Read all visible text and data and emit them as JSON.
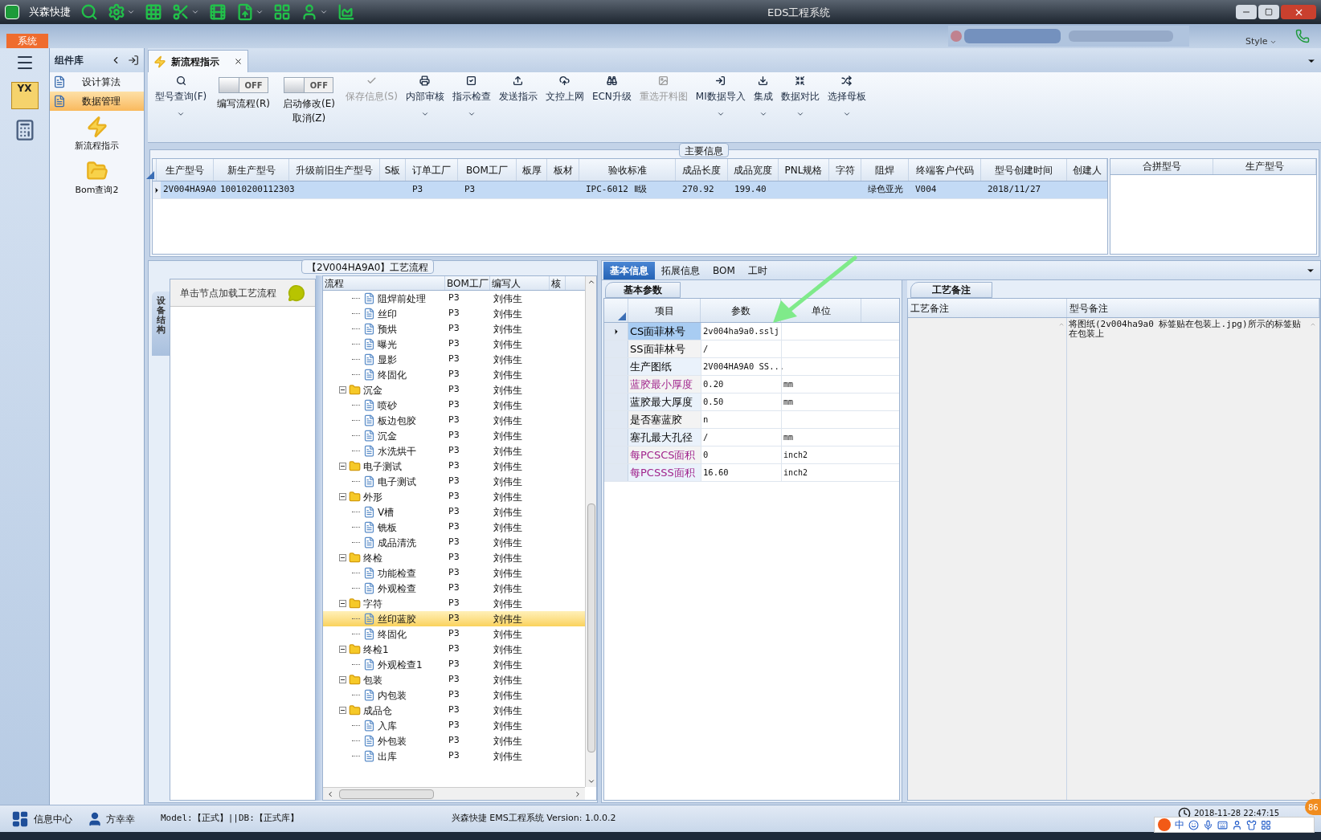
{
  "window": {
    "app_name": "兴森快捷",
    "title": "EDS工程系统"
  },
  "menu": {
    "tabs": [
      {
        "label": "系统",
        "selected": true
      }
    ],
    "style_label": "Style"
  },
  "nav_rail": {
    "logo_text": "YX"
  },
  "component_library": {
    "title": "组件库",
    "items": [
      {
        "label": "设计算法",
        "kind": "row",
        "selected": false
      },
      {
        "label": "数据管理",
        "kind": "row",
        "selected": true
      },
      {
        "label": "新流程指示",
        "kind": "tile",
        "selected": false
      },
      {
        "label": "Bom查询2",
        "kind": "tile",
        "selected": false
      }
    ]
  },
  "document_tabs": [
    {
      "label": "新流程指示",
      "selected": true
    }
  ],
  "ribbon": [
    {
      "kind": "button",
      "label": "型号查询(F)",
      "dropdown": true,
      "disabled": false
    },
    {
      "kind": "toggle",
      "label": "编写流程(R)",
      "switch_text": "OFF",
      "on": false
    },
    {
      "kind": "toggle",
      "label": "启动修改(E)",
      "label_2": "取消(Z)",
      "switch_text": "OFF",
      "on": false
    },
    {
      "kind": "button",
      "label": "保存信息(S)",
      "dropdown": false,
      "disabled": true
    },
    {
      "kind": "button",
      "label": "内部审核",
      "dropdown": true,
      "disabled": false
    },
    {
      "kind": "button",
      "label": "指示检查",
      "dropdown": true,
      "disabled": false
    },
    {
      "kind": "button",
      "label": "发送指示",
      "dropdown": false,
      "disabled": false
    },
    {
      "kind": "button",
      "label": "文控上网",
      "dropdown": false,
      "disabled": false
    },
    {
      "kind": "button",
      "label": "ECN升级",
      "dropdown": false,
      "disabled": false
    },
    {
      "kind": "button",
      "label": "重选开料图",
      "dropdown": false,
      "disabled": true
    },
    {
      "kind": "button",
      "label": "MI数据导入",
      "dropdown": true,
      "disabled": false
    },
    {
      "kind": "button",
      "label": "集成",
      "dropdown": true,
      "disabled": false
    },
    {
      "kind": "button",
      "label": "数据对比",
      "dropdown": true,
      "disabled": false
    },
    {
      "kind": "button",
      "label": "选择母板",
      "dropdown": true,
      "disabled": false
    }
  ],
  "main_info": {
    "title": "主要信息",
    "columns": [
      "生产型号",
      "新生产型号",
      "升级前旧生产型号",
      "S板",
      "订单工厂",
      "BOM工厂",
      "板厚",
      "板材",
      "验收标准",
      "成品长度",
      "成品宽度",
      "PNL规格",
      "字符",
      "阻焊",
      "终端客户代码",
      "型号创建时间",
      "创建人"
    ],
    "rows": [
      {
        "selected": true,
        "cells": [
          "2V004HA9A0",
          "10010200112303",
          null,
          null,
          "P3",
          "P3",
          null,
          null,
          "IPC-6012 Ⅱ级",
          "270.92",
          "199.40",
          null,
          null,
          "绿色亚光",
          "V004",
          "2018/11/27",
          null
        ]
      }
    ],
    "side_columns": [
      "合拼型号",
      "生产型号"
    ]
  },
  "flow_panel": {
    "title": "【2V004HA9A0】工艺流程",
    "side_tab": "设备结构",
    "hint": "单击节点加载工艺流程",
    "columns": [
      "流程",
      "BOM工厂",
      "编写人",
      "核"
    ],
    "tree": [
      {
        "children": [
          {
            "label": "阻焊前处理",
            "bom_factory": "P3",
            "writer": "刘伟生",
            "selected": false
          },
          {
            "label": "丝印",
            "bom_factory": "P3",
            "writer": "刘伟生",
            "selected": false
          },
          {
            "label": "预烘",
            "bom_factory": "P3",
            "writer": "刘伟生",
            "selected": false
          },
          {
            "label": "曝光",
            "bom_factory": "P3",
            "writer": "刘伟生",
            "selected": false
          },
          {
            "label": "显影",
            "bom_factory": "P3",
            "writer": "刘伟生",
            "selected": false
          },
          {
            "label": "终固化",
            "bom_factory": "P3",
            "writer": "刘伟生",
            "selected": false
          }
        ]
      },
      {
        "label": "沉金",
        "bom_factory": "P3",
        "writer": "刘伟生",
        "selected": false,
        "expanded": true,
        "children": [
          {
            "label": "喷砂",
            "bom_factory": "P3",
            "writer": "刘伟生",
            "selected": false
          },
          {
            "label": "板边包胶",
            "bom_factory": "P3",
            "writer": "刘伟生",
            "selected": false
          },
          {
            "label": "沉金",
            "bom_factory": "P3",
            "writer": "刘伟生",
            "selected": false
          },
          {
            "label": "水洗烘干",
            "bom_factory": "P3",
            "writer": "刘伟生",
            "selected": false
          }
        ]
      },
      {
        "label": "电子测试",
        "bom_factory": "P3",
        "writer": "刘伟生",
        "selected": false,
        "expanded": true,
        "children": [
          {
            "label": "电子测试",
            "bom_factory": "P3",
            "writer": "刘伟生",
            "selected": false
          }
        ]
      },
      {
        "label": "外形",
        "bom_factory": "P3",
        "writer": "刘伟生",
        "selected": false,
        "expanded": true,
        "children": [
          {
            "label": "V槽",
            "bom_factory": "P3",
            "writer": "刘伟生",
            "selected": false
          },
          {
            "label": "铣板",
            "bom_factory": "P3",
            "writer": "刘伟生",
            "selected": false
          },
          {
            "label": "成品清洗",
            "bom_factory": "P3",
            "writer": "刘伟生",
            "selected": false
          }
        ]
      },
      {
        "label": "终检",
        "bom_factory": "P3",
        "writer": "刘伟生",
        "selected": false,
        "expanded": true,
        "children": [
          {
            "label": "功能检查",
            "bom_factory": "P3",
            "writer": "刘伟生",
            "selected": false
          },
          {
            "label": "外观检查",
            "bom_factory": "P3",
            "writer": "刘伟生",
            "selected": false
          }
        ]
      },
      {
        "label": "字符",
        "bom_factory": "P3",
        "writer": "刘伟生",
        "selected": false,
        "expanded": true,
        "children": [
          {
            "label": "丝印蓝胶",
            "bom_factory": "P3",
            "writer": "刘伟生",
            "selected": true
          },
          {
            "label": "终固化",
            "bom_factory": "P3",
            "writer": "刘伟生",
            "selected": false
          }
        ]
      },
      {
        "label": "终检1",
        "bom_factory": "P3",
        "writer": "刘伟生",
        "selected": false,
        "expanded": true,
        "children": [
          {
            "label": "外观检查1",
            "bom_factory": "P3",
            "writer": "刘伟生",
            "selected": false
          }
        ]
      },
      {
        "label": "包装",
        "bom_factory": "P3",
        "writer": "刘伟生",
        "selected": false,
        "expanded": true,
        "children": [
          {
            "label": "内包装",
            "bom_factory": "P3",
            "writer": "刘伟生",
            "selected": false
          }
        ]
      },
      {
        "label": "成品仓",
        "bom_factory": "P3",
        "writer": "刘伟生",
        "selected": false,
        "expanded": true,
        "children": [
          {
            "label": "入库",
            "bom_factory": "P3",
            "writer": "刘伟生",
            "selected": false
          },
          {
            "label": "外包装",
            "bom_factory": "P3",
            "writer": "刘伟生",
            "selected": false
          },
          {
            "label": "出库",
            "bom_factory": "P3",
            "writer": "刘伟生",
            "selected": false
          }
        ]
      }
    ]
  },
  "detail_panel": {
    "tabs": [
      {
        "label": "基本信息",
        "selected": true
      },
      {
        "label": "拓展信息",
        "selected": false
      },
      {
        "label": "BOM",
        "selected": false
      },
      {
        "label": "工时",
        "selected": false
      }
    ],
    "params": {
      "tab": "基本参数",
      "columns": [
        "项目",
        "参数",
        "单位"
      ],
      "rows": [
        {
          "item": "CS面菲林号",
          "value": "2v004ha9a0.sslj",
          "highlighted": false,
          "selected": true
        },
        {
          "item": "SS面菲林号",
          "value": "/",
          "highlighted": false,
          "selected": false
        },
        {
          "item": "生产图纸",
          "value": "2V004HA9A0 SS...",
          "highlighted": false,
          "selected": false
        },
        {
          "item": "蓝胶最小厚度",
          "value": "0.20",
          "unit": "mm",
          "highlighted": true,
          "selected": false
        },
        {
          "item": "蓝胶最大厚度",
          "value": "0.50",
          "unit": "mm",
          "highlighted": false,
          "selected": false
        },
        {
          "item": "是否塞蓝胶",
          "value": "n",
          "highlighted": false,
          "selected": false
        },
        {
          "item": "塞孔最大孔径",
          "value": "/",
          "unit": "mm",
          "highlighted": false,
          "selected": false
        },
        {
          "item": "每PCSCS面积",
          "value": "0",
          "unit": "inch2",
          "highlighted": true,
          "selected": false
        },
        {
          "item": "每PCSSS面积",
          "value": "16.60",
          "unit": "inch2",
          "highlighted": true,
          "selected": false
        }
      ]
    },
    "remarks": {
      "tab": "工艺备注",
      "columns": [
        "工艺备注",
        "型号备注"
      ],
      "model_note": "将图纸(2v004ha9a0 标签贴在包装上.jpg)所示的标签贴在包装上"
    }
  },
  "status_bar": {
    "info_center": "信息中心",
    "user": "方幸幸",
    "environment": "Model:【正式】||DB:【正式库】",
    "version": "兴森快捷 EMS工程系统 Version: 1.0.0.2",
    "datetime": "2018-11-28 22:47:15",
    "ime": "中",
    "badge": "86"
  }
}
